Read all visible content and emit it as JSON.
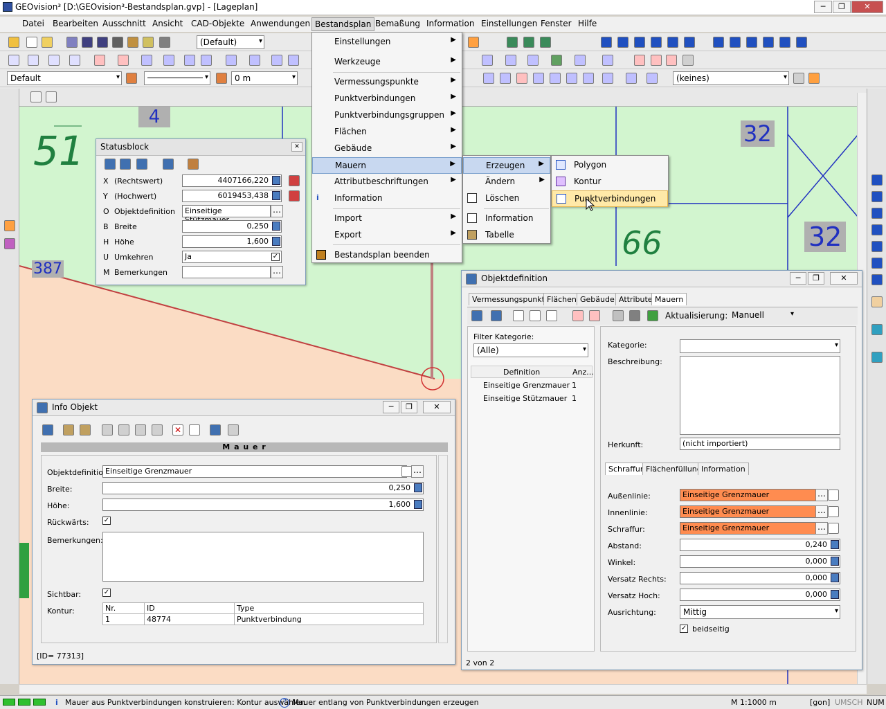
{
  "window": {
    "title": "GEOvision³  [D:\\GEOvision³-Bestandsplan.gvp] - [Lageplan]"
  },
  "menubar": [
    "Datei",
    "Bearbeiten",
    "Ausschnitt",
    "Ansicht",
    "CAD-Objekte",
    "Anwendungen",
    "Bestandsplan",
    "Bemaßung",
    "Information",
    "Einstellungen",
    "Fenster",
    "Hilfe"
  ],
  "toolbar": {
    "style_default": "(Default)",
    "layer_default": "Default",
    "offset": "0 m",
    "keines": "(keines)"
  },
  "canvas": {
    "labels": [
      "51",
      "4",
      "387",
      "66",
      "32",
      "32"
    ]
  },
  "statusblock": {
    "title": "Statusblock",
    "rows": [
      {
        "key": "X",
        "label": "(Rechtswert)",
        "value": "4407166,220"
      },
      {
        "key": "Y",
        "label": "(Hochwert)",
        "value": "6019453,438"
      },
      {
        "key": "O",
        "label": "Objektdefinition",
        "value": "Einseitige Stützmauer"
      },
      {
        "key": "B",
        "label": "Breite",
        "value": "0,250"
      },
      {
        "key": "H",
        "label": "Höhe",
        "value": "1,600"
      },
      {
        "key": "U",
        "label": "Umkehren",
        "value": "Ja"
      },
      {
        "key": "M",
        "label": "Bemerkungen",
        "value": ""
      }
    ]
  },
  "menu_bestandsplan": {
    "items": [
      "Einstellungen",
      "Werkzeuge",
      "Vermessungspunkte",
      "Punktverbindungen",
      "Punktverbindungsgruppen",
      "Flächen",
      "Gebäude",
      "Mauern",
      "Attributbeschriftungen",
      "Information",
      "Import",
      "Export",
      "Bestandsplan beenden"
    ]
  },
  "menu_mauern": {
    "items": [
      "Erzeugen",
      "Ändern",
      "Löschen",
      "Information",
      "Tabelle"
    ]
  },
  "menu_erzeugen": {
    "items": [
      "Polygon",
      "Kontur",
      "Punktverbindungen"
    ]
  },
  "info": {
    "title": "Info Objekt",
    "header": "M a u e r",
    "objektdefinition_label": "Objektdefinition:",
    "objektdefinition": "Einseitige Grenzmauer",
    "breite_label": "Breite:",
    "breite": "0,250",
    "hoehe_label": "Höhe:",
    "hoehe": "1,600",
    "rueck_label": "Rückwärts:",
    "bemerk_label": "Bemerkungen:",
    "sichtbar_label": "Sichtbar:",
    "kontur_label": "Kontur:",
    "kontur_headers": [
      "Nr.",
      "ID",
      "Type"
    ],
    "kontur_rows": [
      [
        "1",
        "48774",
        "Punktverbindung"
      ]
    ],
    "status": "[ID= 77313]"
  },
  "objdef": {
    "title": "Objektdefinition",
    "tabs": [
      "Vermessungspunkte",
      "Flächen",
      "Gebäude",
      "Attribute",
      "Mauern"
    ],
    "aktual_label": "Aktualisierung:",
    "aktual": "Manuell",
    "filter_label": "Filter Kategorie:",
    "filter": "(Alle)",
    "list_headers": [
      "Definition",
      "Anz..."
    ],
    "list_rows": [
      [
        "Einseitige Grenzmauer",
        "1"
      ],
      [
        "Einseitige Stützmauer",
        "1"
      ]
    ],
    "kategorie_label": "Kategorie:",
    "beschreibung_label": "Beschreibung:",
    "herkunft_label": "Herkunft:",
    "herkunft": "(nicht importiert)",
    "subtabs": [
      "Schraffur",
      "Flächenfüllung",
      "Information"
    ],
    "aussen_label": "Außenlinie:",
    "aussen": "Einseitige Grenzmauer",
    "innen_label": "Innenlinie:",
    "innen": "Einseitige Grenzmauer",
    "schraffur_label": "Schraffur:",
    "schraffur": "Einseitige Grenzmauer",
    "abstand_label": "Abstand:",
    "abstand": "0,240",
    "winkel_label": "Winkel:",
    "winkel": "0,000",
    "vr_label": "Versatz Rechts:",
    "vr": "0,000",
    "vh_label": "Versatz Hoch:",
    "vh": "0,000",
    "ausr_label": "Ausrichtung:",
    "ausr": "Mittig",
    "beidseitig": "beidseitig",
    "count": "2 von 2"
  },
  "statusbar": {
    "msg1": "Mauer aus Punktverbindungen konstruieren: Kontur auswählen",
    "msg2": "Mauer entlang von Punktverbindungen erzeugen",
    "scale": "M 1:1000  m",
    "gon": "[gon]",
    "umsch": "UMSCH",
    "num": "NUM"
  }
}
